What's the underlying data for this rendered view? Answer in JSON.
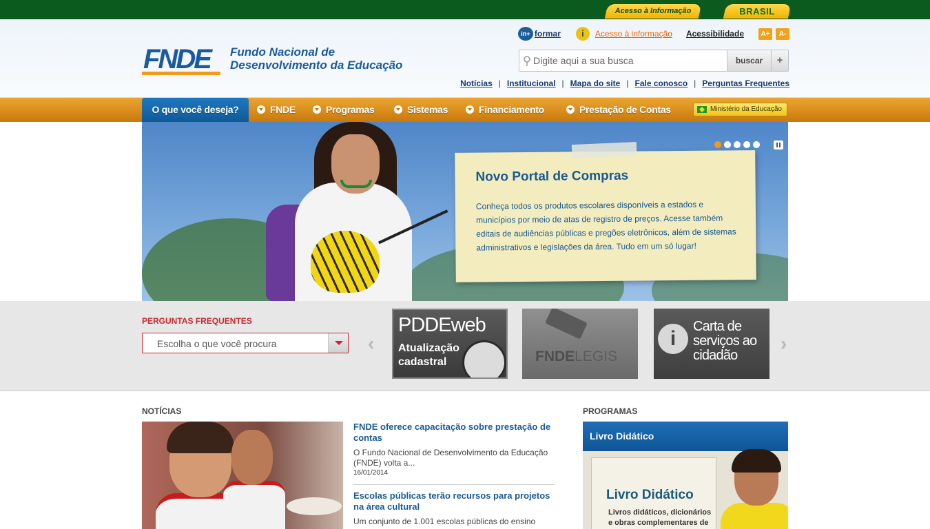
{
  "govbar": {
    "acesso": "Acesso à Informação",
    "brasil": "BRASIL"
  },
  "header": {
    "logo_text": "FNDE",
    "org_name_line1": "Fundo Nacional de",
    "org_name_line2": "Desenvolvimento da Educação",
    "infor_badge": "in+",
    "infor_label": "formar",
    "info_icon": "i",
    "acesso_info": "Acesso à informação",
    "acessibilidade": "Acessibilidade",
    "font_increase": "A+",
    "font_decrease": "A-",
    "search_placeholder": "Digite aqui a sua busca",
    "search_button": "buscar",
    "search_plus": "+",
    "links": [
      "Notícias",
      "Institucional",
      "Mapa do site",
      "Fale conosco",
      "Perguntas Frequentes"
    ],
    "separator": "|"
  },
  "nav": {
    "items": [
      "O que você deseja?",
      "FNDE",
      "Programas",
      "Sistemas",
      "Financiamento",
      "Prestação de Contas"
    ],
    "ministerio": "Ministério da Educação"
  },
  "banner": {
    "title": "Novo Portal de Compras",
    "body": "Conheça todos os produtos escolares disponíveis a estados e municípios por meio de atas de registro de preços. Acesse também editais de audiências públicas e pregões eletrônicos, além de sistemas administrativos e legislações da área. Tudo em um só lugar!",
    "slides_total": 5,
    "slide_active": 1
  },
  "faq": {
    "title": "PERGUNTAS FREQUENTES",
    "select_value": "Escolha o que você procura"
  },
  "carousel": {
    "prev": "‹",
    "next": "›",
    "tile1_title": "PDDEweb",
    "tile1_sub": "Atualização cadastral",
    "tile2_part1": "FNDE",
    "tile2_part2": "LEGIS",
    "tile3_icon": "i",
    "tile3_text": "Carta de serviços ao cidadão"
  },
  "news": {
    "title": "NOTÍCIAS",
    "items": [
      {
        "headline": "FNDE oferece capacitação sobre prestação de contas",
        "text": "O Fundo Nacional de Desenvolvimento da Educação (FNDE) volta a...",
        "date": "16/01/2014"
      },
      {
        "headline": "Escolas públicas terão recursos para projetos na área cultural",
        "text": "Um conjunto de 1.001 escolas públicas do ensino",
        "date": ""
      }
    ]
  },
  "programs": {
    "title": "PROGRAMAS",
    "box_title": "Livro Didático",
    "book_title": "Livro Didático",
    "book_sub_line1": "Livros didáticos, dicionários",
    "book_sub_line2": "e obras complementares de"
  },
  "colors": {
    "gov_green": "#0b5a1e",
    "nav_orange": "#e08f1e",
    "brand_blue": "#1a5a9e",
    "faq_red": "#c4282e",
    "accent_orange": "#f29a1c"
  }
}
